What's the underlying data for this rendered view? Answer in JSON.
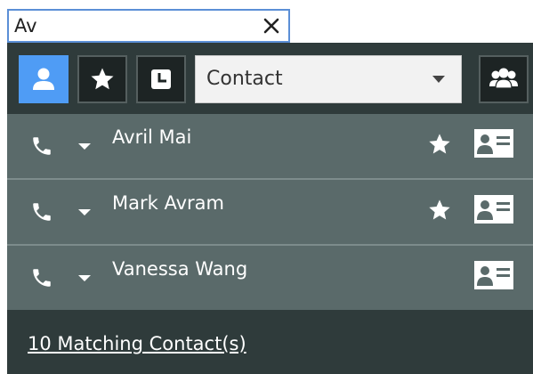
{
  "search": {
    "value": "Av",
    "clear_icon": "close-icon"
  },
  "toolbar": {
    "contact_icon": "person-icon",
    "favorites_icon": "star-icon",
    "recent_icon": "clock-icon",
    "filter_selected": "Contact",
    "group_icon": "group-icon",
    "colors": {
      "active": "#4f9cf5",
      "panel": "#2f3b3b",
      "row": "#5a6a6a"
    }
  },
  "contacts": [
    {
      "name": "Avril Mai",
      "favorite": true
    },
    {
      "name": "Mark Avram",
      "favorite": true
    },
    {
      "name": "Vanessa Wang",
      "favorite": false
    }
  ],
  "footer": {
    "matches": "10 Matching Contact(s)"
  }
}
